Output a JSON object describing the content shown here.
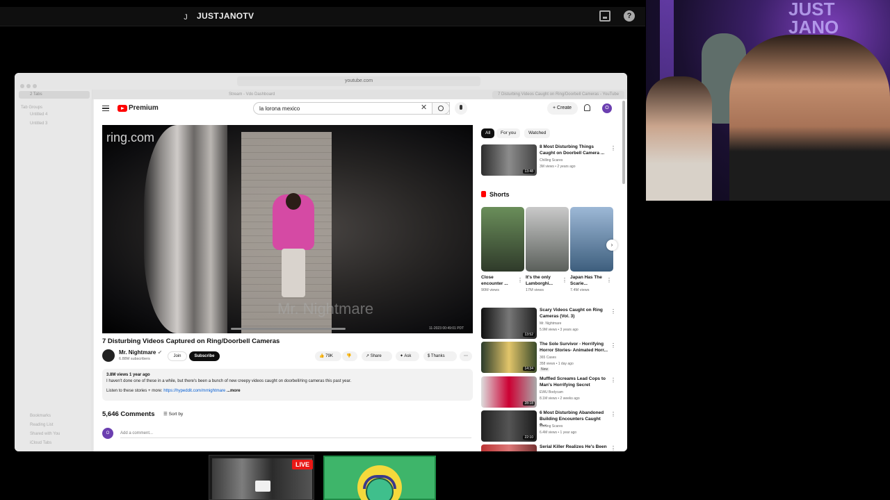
{
  "topbar": {
    "avatar_letter": "J",
    "channel_name": "JUSTJANOTV",
    "help_label": "?"
  },
  "webcam": {
    "overlay_text": "JUST\nJANO"
  },
  "browser": {
    "url": "youtube.com",
    "tabs": [
      {
        "label": "Stream - Vdo Dashboard"
      },
      {
        "label": "7 Disturbing Videos Caught on Ring/Doorbell Cameras - YouTube"
      }
    ],
    "sidebar": {
      "tabs_count": "2 Tabs",
      "section": "Tab Groups",
      "items": [
        "Untitled 4",
        "Untitled 3"
      ],
      "bottom_items": [
        "Bookmarks",
        "Reading List",
        "Shared with You",
        "iCloud Tabs"
      ]
    }
  },
  "youtube": {
    "brand": "Premium",
    "search_value": "la lorona  mexico",
    "create_label": "Create",
    "avatar_letter": "O",
    "player": {
      "ring_logo": "ring.com",
      "watermark": "Mr. Nightmare",
      "timestamp": "11-2023 00:49:01 PDT"
    },
    "video": {
      "title": "7 Disturbing Videos Captured on Ring/Doorbell Cameras",
      "channel": "Mr. Nightmare",
      "subscribers": "6.88M subscribers",
      "join_label": "Join",
      "subscribe_label": "Subscribe",
      "likes": "79K",
      "share_label": "Share",
      "ask_label": "Ask",
      "thanks_label": "Thanks",
      "views": "3.8M views",
      "age": "1 year ago",
      "description": "I haven't done one of these in a while, but there's been a bunch of new creepy videos caught on doorbell/ring cameras this past year.",
      "listen_prefix": "Listen to these stories + more:",
      "listen_link": "https://hypeddit.com/mrnightmare",
      "more_label": "...more"
    },
    "comments": {
      "count_label": "5,646 Comments",
      "sort_label": "Sort by",
      "add_placeholder": "Add a comment...",
      "avatar_letter": "O"
    },
    "chips": [
      "All",
      "For you",
      "Watched"
    ],
    "recommendations_top": {
      "title": "8 Most Disturbing Things Caught on Doorbell Camera ...",
      "channel": "Chilling Scares",
      "meta": "3M views • 2 years ago",
      "duration": "13:48"
    },
    "shorts": {
      "heading": "Shorts",
      "items": [
        {
          "title": "Close encounter ...",
          "views": "90M views"
        },
        {
          "title": "It's the only Lamborghi...",
          "views": "17M views"
        },
        {
          "title": "Japan Has The Scarie...",
          "views": "7.4M views"
        }
      ]
    },
    "recommendations": [
      {
        "title": "Scary Videos Caught on Ring Cameras (Vol. 3)",
        "channel": "Mr. Nightmare",
        "meta": "5.9M views • 3 years ago",
        "duration": "13:52",
        "badge": ""
      },
      {
        "title": "The Sole Survivor - Horrifying Horror Stories- Animated Horr...",
        "channel": "365 Cases",
        "meta": "358 views • 1 day ago",
        "duration": "14:34",
        "badge": "New"
      },
      {
        "title": "Muffled Screams Lead Cops to Man's Horrifying Secret",
        "channel": "EWU Bodycam",
        "meta": "8.1M views • 2 weeks ago",
        "duration": "28:18",
        "badge": ""
      },
      {
        "title": "6 Most Disturbing Abandoned Building Encounters Caught o...",
        "channel": "Chilling Scares",
        "meta": "6.4M views • 1 year ago",
        "duration": "22:10",
        "badge": ""
      },
      {
        "title": "Serial Killer Realizes He's Been",
        "channel": "",
        "meta": "",
        "duration": "",
        "badge": ""
      }
    ]
  },
  "overlays": {
    "live_badge": "LIVE"
  },
  "colors": {
    "accent_red": "#e91916",
    "yt_red": "#ff0000",
    "purple": "#6b3fb0",
    "green_tile": "#3eb56a"
  }
}
